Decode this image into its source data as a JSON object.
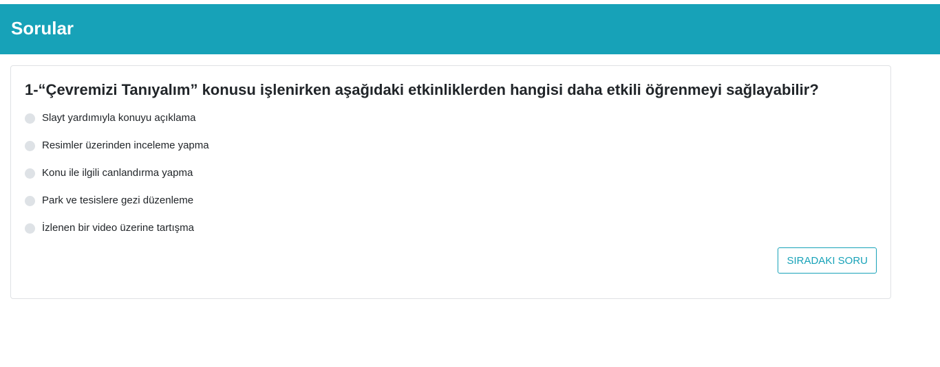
{
  "header": {
    "title": "Sorular"
  },
  "quiz": {
    "question": "1-“Çevremizi Tanıyalım” konusu işlenirken aşağıdaki etkinliklerden hangisi daha etkili öğrenmeyi sağlayabilir?",
    "options": [
      {
        "label": "Slayt yardımıyla konuyu açıklama",
        "selected": false
      },
      {
        "label": "Resimler üzerinden inceleme yapma",
        "selected": false
      },
      {
        "label": "Konu ile ilgili canlandırma yapma",
        "selected": false
      },
      {
        "label": "Park ve tesislere gezi düzenleme",
        "selected": false
      },
      {
        "label": "İzlenen bir video üzerine tartışma",
        "selected": false
      }
    ],
    "next_label": "SIRADAKI SORU"
  },
  "colors": {
    "accent": "#17a2b8",
    "radio": "#dee2e6",
    "border": "#dfe1e4"
  }
}
